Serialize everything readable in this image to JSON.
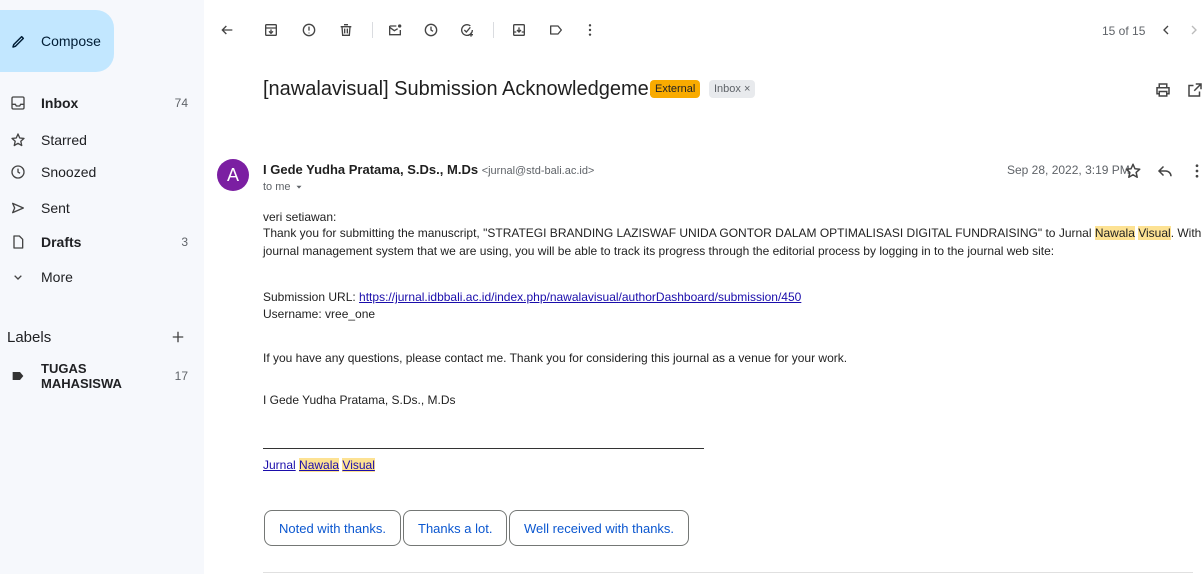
{
  "sidebar": {
    "compose_label": "Compose",
    "items": [
      {
        "label": "Inbox",
        "count": "74"
      },
      {
        "label": "Starred",
        "count": ""
      },
      {
        "label": "Snoozed",
        "count": ""
      },
      {
        "label": "Sent",
        "count": ""
      },
      {
        "label": "Drafts",
        "count": "3"
      },
      {
        "label": "More",
        "count": ""
      }
    ],
    "labels_heading": "Labels",
    "labels": [
      {
        "label": "TUGAS MAHASISWA",
        "count": "17"
      }
    ]
  },
  "toolbar": {
    "page_info": "15 of 15"
  },
  "message": {
    "subject": "[nawalavisual] Submission Acknowledgement",
    "badge_external": "External",
    "badge_inbox": "Inbox ×",
    "sender_initial": "A",
    "sender_name": "I Gede Yudha Pratama, S.Ds., M.Ds",
    "sender_email": "<jurnal@std-bali.ac.id>",
    "to_me": "to me",
    "date": "Sep 28, 2022, 3:19 PM",
    "body": {
      "greeting": "veri setiawan:",
      "para1_a": "Thank you for submitting the manuscript, \"STRATEGI BRANDING LAZISWAF UNIDA GONTOR DALAM OPTIMALISASI DIGITAL FUNDRAISING\" to Jurnal ",
      "hl_nawala": "Nawala",
      "hl_visual": "Visual",
      "para1_b": ". With the online",
      "para1_line2": "journal management system that we are using, you will be able to track its progress through the editorial process by logging in to the journal web site:",
      "url_label": "Submission URL: ",
      "url": "https://jurnal.idbbali.ac.id/index.php/nawalavisual/authorDashboard/submission/450",
      "username": "Username: vree_one",
      "questions": "If you have any questions, please contact me. Thank you for considering this journal as a venue for your work.",
      "signature": "I Gede Yudha Pratama, S.Ds., M.Ds",
      "footer_jurnal": "Jurnal"
    },
    "quick_replies": [
      "Noted with thanks.",
      "Thanks a lot.",
      "Well received with thanks."
    ]
  },
  "icons": {
    "back": "arrow-left-icon",
    "archive": "archive-icon",
    "report": "report-spam-icon",
    "delete": "trash-icon",
    "mark_unread": "mark-unread-icon",
    "snooze": "clock-icon",
    "add_task": "add-task-icon",
    "move": "move-to-icon",
    "label": "label-icon",
    "more": "more-vert-icon",
    "print": "print-icon",
    "open_new": "open-new-window-icon",
    "star": "star-icon",
    "reply": "reply-icon"
  },
  "colors": {
    "sidebar_bg": "#f6f8fc",
    "compose_bg": "#c2e7ff",
    "external_badge": "#f9ab00",
    "avatar": "#7b1fa2",
    "highlight": "#fde293",
    "link": "#1a0dab",
    "quick_reply_text": "#0b57d0"
  }
}
